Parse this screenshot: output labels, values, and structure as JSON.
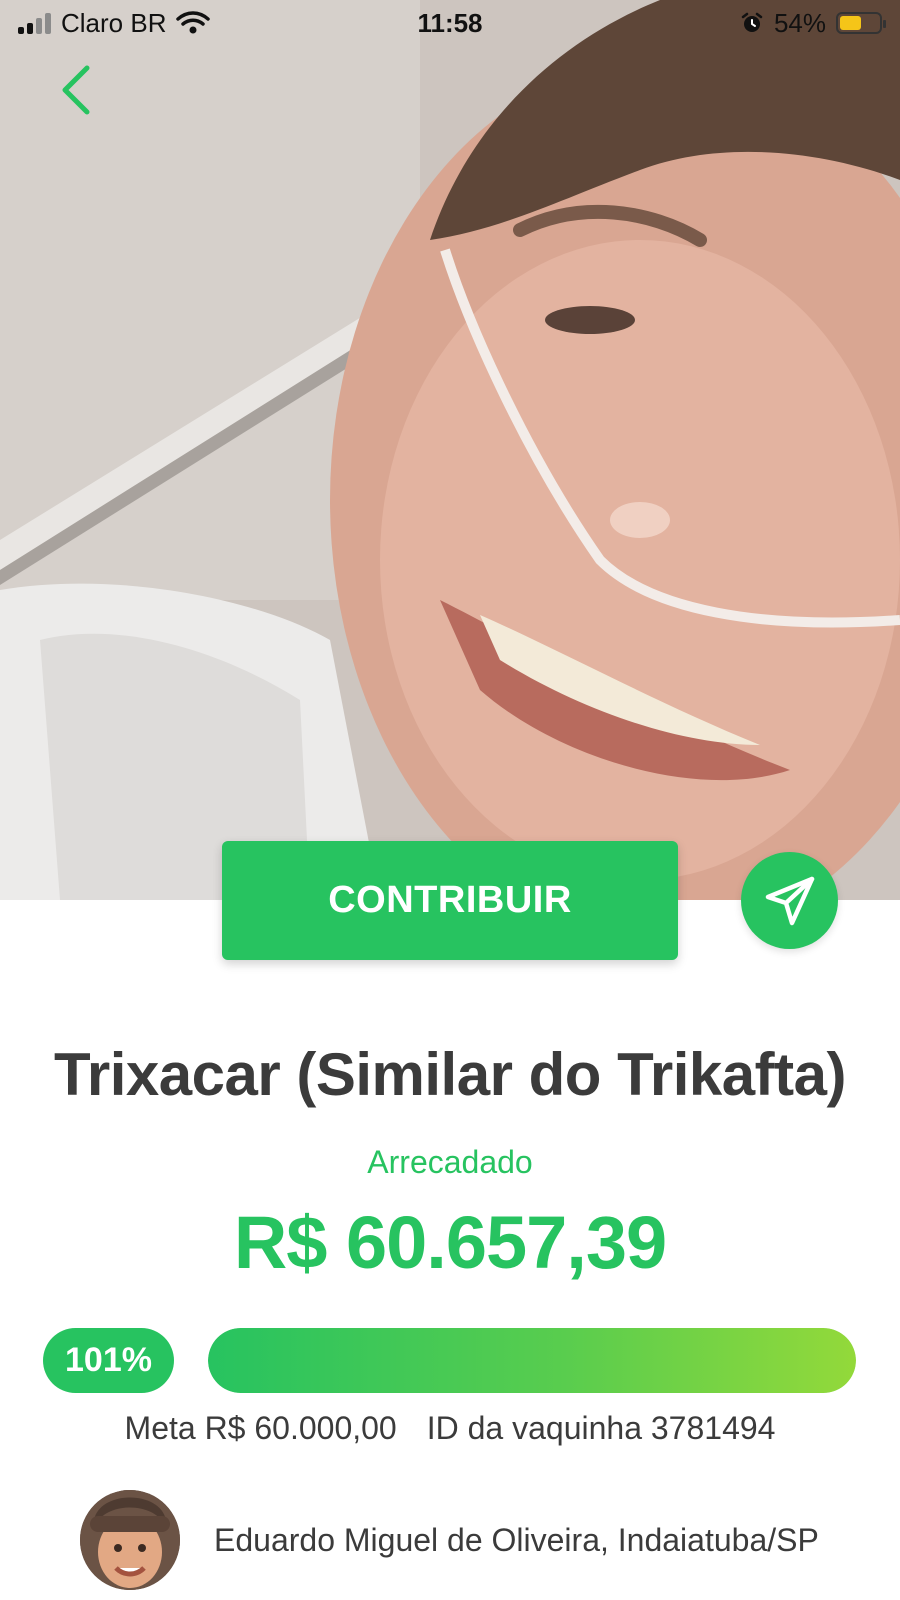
{
  "status_bar": {
    "carrier": "Claro BR",
    "time": "11:58",
    "battery_percent": "54%",
    "battery_level": 0.54,
    "signal_bars": 2,
    "icons": [
      "signal-icon",
      "wifi-icon",
      "alarm-icon",
      "battery-icon"
    ]
  },
  "navigation": {
    "back_icon": "chevron-left-icon"
  },
  "actions": {
    "contribute_label": "CONTRIBUIR",
    "share_icon": "paper-plane-icon"
  },
  "campaign": {
    "title": "Trixacar (Similar do Trikafta)",
    "raised_label": "Arrecadado",
    "raised_amount": "R$ 60.657,39",
    "percent_label": "101%",
    "progress_fraction": 1.0,
    "goal": "Meta R$ 60.000,00",
    "campaign_id": "ID da vaquinha 3781494"
  },
  "creator": {
    "name_location": "Eduardo Miguel de Oliveira, Indaiatuba/SP"
  },
  "colors": {
    "accent": "#27c360",
    "progress_end": "#93d93a",
    "text_dark": "#3b3b3b"
  }
}
